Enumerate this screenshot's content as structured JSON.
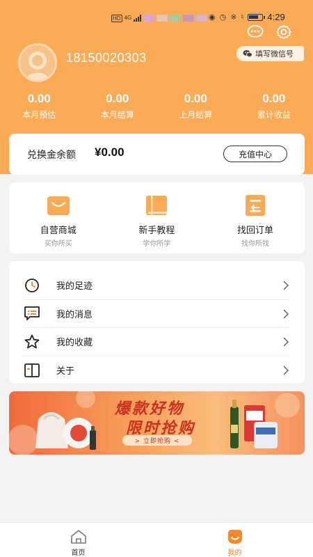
{
  "status_bar": {
    "network_label": "HD",
    "signal_label": "4G",
    "time": "4:29"
  },
  "header": {
    "wechat_button_label": "填写微信号",
    "phone": "18150020303"
  },
  "stats": [
    {
      "value": "0.00",
      "label": "本月预估"
    },
    {
      "value": "0.00",
      "label": "本月结算"
    },
    {
      "value": "0.00",
      "label": "上月结算"
    },
    {
      "value": "0.00",
      "label": "累计收益"
    }
  ],
  "balance": {
    "label": "兑换金余额",
    "value": "¥0.00",
    "recharge_label": "充值中心"
  },
  "shortcuts": [
    {
      "title": "自营商城",
      "subtitle": "买你所买",
      "icon": "shopping-bag-icon"
    },
    {
      "title": "新手教程",
      "subtitle": "学你所学",
      "icon": "book-icon"
    },
    {
      "title": "找回订单",
      "subtitle": "找你所找",
      "icon": "order-return-icon"
    }
  ],
  "menu": [
    {
      "label": "我的足迹",
      "icon": "clock-icon"
    },
    {
      "label": "我的消息",
      "icon": "message-icon"
    },
    {
      "label": "我的收藏",
      "icon": "star-icon"
    },
    {
      "label": "关于",
      "icon": "about-book-icon"
    }
  ],
  "banner": {
    "title_line1": "爆款好物",
    "title_line2": "限时抢购",
    "cta": "> 立即抢购 <"
  },
  "bottom_nav": [
    {
      "label": "首页",
      "icon": "home-icon",
      "active": false
    },
    {
      "label": "我的",
      "icon": "profile-icon",
      "active": true
    }
  ],
  "colors": {
    "accent": "#fbab56",
    "active_nav": "#f5892c",
    "banner_text": "#c8321e"
  }
}
